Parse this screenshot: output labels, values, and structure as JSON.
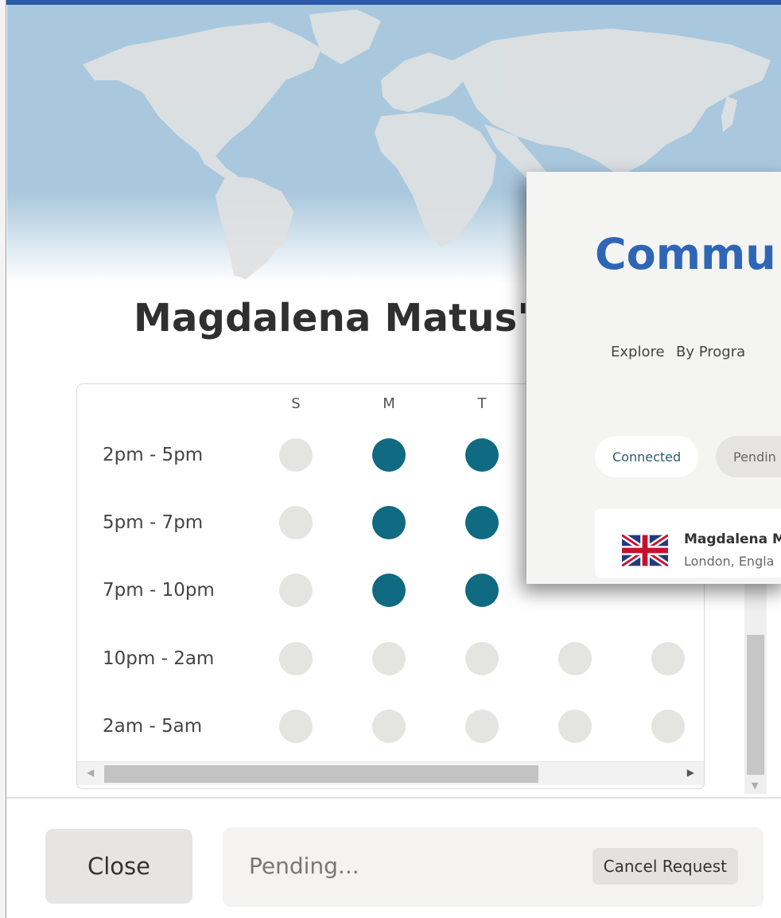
{
  "modal": {
    "title": "Magdalena Matus'",
    "days": [
      "S",
      "M",
      "T"
    ],
    "time_slots": [
      "2pm - 5pm",
      "5pm - 7pm",
      "7pm - 10pm",
      "10pm - 2am",
      "2am - 5am"
    ],
    "availability": [
      [
        false,
        true,
        true,
        null,
        null
      ],
      [
        false,
        true,
        true,
        null,
        null
      ],
      [
        false,
        true,
        true,
        null,
        null
      ],
      [
        false,
        false,
        false,
        false,
        false
      ],
      [
        false,
        false,
        false,
        false,
        false
      ]
    ]
  },
  "footer": {
    "close_label": "Close",
    "status_text": "Pending...",
    "cancel_label": "Cancel Request"
  },
  "overlay": {
    "title": "Commu",
    "nav": [
      "Explore",
      "By Progra"
    ],
    "chips": [
      "Connected",
      "Pendin"
    ],
    "member": {
      "name": "Magdalena M",
      "location": "London, Engla"
    }
  },
  "colors": {
    "available": "#0f6a82",
    "unavailable": "#e4e4e1",
    "overlay_title": "#2e66b5",
    "top_stripe": "#2a5aa8"
  },
  "icons": {
    "flag": "uk-flag-icon",
    "scroll_left": "arrow-left-icon",
    "scroll_right": "arrow-right-icon",
    "scroll_down": "arrow-down-icon"
  }
}
